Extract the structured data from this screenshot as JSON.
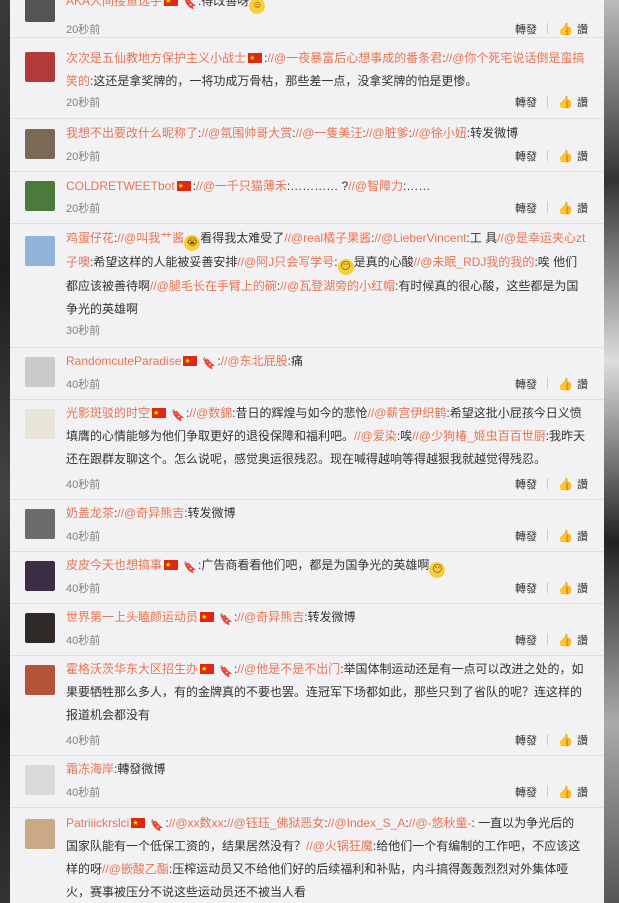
{
  "comments": [
    {
      "name": "AKA人间接鱼选手",
      "pieces": [
        ":得改善呀"
      ],
      "time": "20秒前"
    },
    {
      "name": "次次是五仙教地方保护主义小战士",
      "pieces": [
        ":",
        "//@一夜暴富后心想事成的番条君",
        ":",
        "//@你个死宅说话倒是蛮搞笑的",
        ":这还是拿奖牌的，一将功成万骨枯，那些差一点，没拿奖牌的怕是更惨。"
      ],
      "time": "20秒前"
    },
    {
      "name": "我想不出要改什么昵称了",
      "pieces": [
        ":",
        "//@氛围帅哥大赏",
        ":",
        "//@一隻美汪",
        ":",
        "//@脏爹",
        ":",
        "//@徐小妞",
        ":转发微博"
      ],
      "time": "20秒前"
    },
    {
      "name": "COLDRETWEETbot",
      "pieces": [
        ":",
        "//@一千只猫薄禾",
        ":………… ?",
        "//@智障力",
        ":……"
      ],
      "time": "20秒前"
    },
    {
      "name": "鸡蛋仔花",
      "pieces": [
        ":",
        "//@叫我艹酱",
        "看得我太难受了",
        "//@real橘子果酱",
        ":",
        "//@LieberVincent",
        ":工 具",
        "//@是幸运夹心zt子噢",
        ":希望这样的人能被妥善安排",
        "//@阿J只会写学号",
        ":",
        "是真的心酸",
        "//@未眠_RDJ我的我的",
        ":唉 他们都应该被善待啊",
        "//@腿毛长在手臂上的碗",
        ":",
        "//@瓦登湖旁的小红帽",
        ":有时候真的很心酸，这些都是为国争光的英雄啊"
      ],
      "time": "30秒前"
    },
    {
      "name": "RandomcuteParadise",
      "pieces": [
        ":",
        "//@东北屁股",
        ":痛"
      ],
      "time": "40秒前"
    },
    {
      "name": "光影斑驳的时空",
      "pieces": [
        ":",
        "//@数錦",
        ":昔日的辉煌与如今的悲怆",
        "//@薪宫伊织鹤",
        ":希望这批小屁孩今日义愤填膺的心情能够为他们争取更好的退役保障和福利吧。",
        "//@爱染",
        ":唉",
        "//@少狗椿_姬虫百百世厨",
        ":我昨天还在跟群友聊这个。怎么说呢，感觉奥运很残忍。现在喊得越响等得越狠我就越觉得残忍。"
      ],
      "time": "40秒前"
    },
    {
      "name": "奶盖龙茶",
      "pieces": [
        ":",
        "//@奇异熊吉",
        ":转发微博"
      ],
      "time": "40秒前"
    },
    {
      "name": "皮皮今天也想搞事",
      "pieces": [
        ":广告商看看他们吧，都是为国争光的英雄啊"
      ],
      "time": "40秒前"
    },
    {
      "name": "世界第一上头瞌颜运动员",
      "pieces": [
        ":",
        "//@奇异熊吉",
        ":转发微博"
      ],
      "time": "40秒前"
    },
    {
      "name": "霍格沃茨华东大区招生办",
      "pieces": [
        ":",
        "//@他是不是不出门",
        ":举国体制运动还是有一点可以改进之处的，如果要牺牲那么多人，有的金牌真的不要也罢。连冠军下场都如此，那些只到了省队的呢？连这样的报道机会都没有"
      ],
      "time": "40秒前"
    },
    {
      "name": "霜冻海岸",
      "pieces": [
        ":轉發微博"
      ],
      "time": "40秒前"
    },
    {
      "name": "Patriiickrslci",
      "pieces": [
        ":",
        "//@xx数xx",
        ":",
        "//@钰珏_佛狱恶女",
        ":",
        "//@Index_S_A",
        ":",
        "//@-悠秋童-",
        ": 一直以为争光后的国家队能有一个低保工资的，结果居然没有？",
        "//@火锅狂魔",
        ":给他们一个有编制的工作吧，不应该这样的呀",
        "//@嵌酸乙酯",
        ":压榨运动员又不给他们好的后续福利和补贴，内斗搞得轰轰烈烈对外集体哑火，赛事被压分不说这些运动员还不被当人看"
      ],
      "time": ""
    }
  ],
  "actions": {
    "repost": "轉發",
    "like": "讚"
  },
  "icons": {
    "like": "thumbs-up-icon",
    "flag": "china-flag-icon",
    "badge": "medal-badge-icon"
  },
  "colors": {
    "username": "#eb7350",
    "text": "#333333",
    "time": "#808080",
    "panel": "#f2f2f5"
  }
}
